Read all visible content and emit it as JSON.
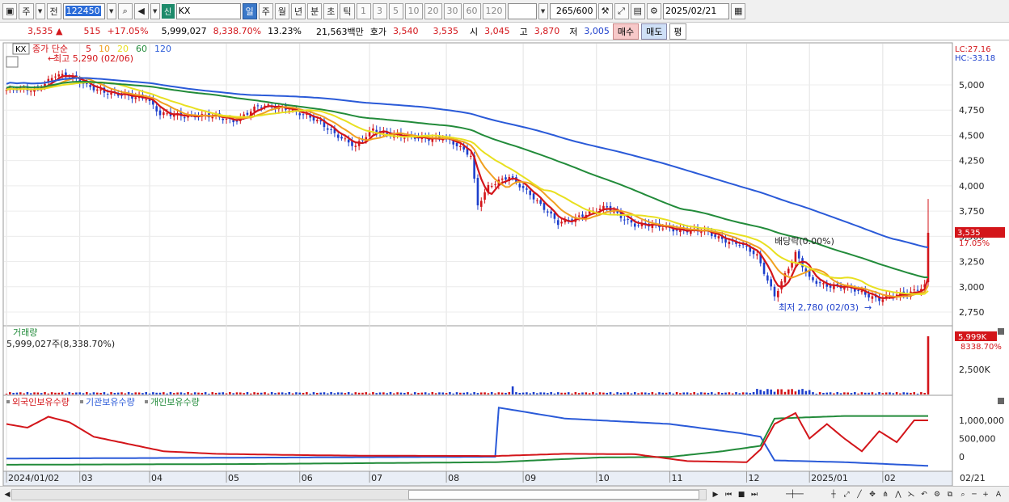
{
  "toolbar": {
    "period_ju": "주",
    "jeon_label": "전",
    "stock_code": "122450",
    "new_badge": "신",
    "stock_name": "KX",
    "periods": [
      "일",
      "주",
      "월",
      "년",
      "분",
      "초",
      "틱"
    ],
    "selected_period": "일",
    "intervals": [
      "1",
      "3",
      "5",
      "10",
      "20",
      "30",
      "60",
      "120"
    ],
    "count_value": "265",
    "count_total": "/600",
    "date_value": "2025/02/21"
  },
  "infobar": {
    "price": "3,535",
    "change_arrow": "▲",
    "change": "515",
    "change_pct": "+17.05%",
    "volume": "5,999,027",
    "volume_pct": "8,338.70%",
    "turnover": "13.23%",
    "amount": "21,563백만",
    "hoga_label": "호가",
    "ask": "3,540",
    "bid": "3,535",
    "open_label": "시",
    "open": "3,045",
    "high_label": "고",
    "high": "3,870",
    "low_label": "저",
    "low": "3,005",
    "buy_label": "매수",
    "sell_label": "매도",
    "p_label": "평"
  },
  "price_panel": {
    "title_name": "KX",
    "legend_label": "종가 단순",
    "ma_periods": [
      {
        "label": "5",
        "color": "#d3151a"
      },
      {
        "label": "10",
        "color": "#f0a020"
      },
      {
        "label": "20",
        "color": "#e8e020"
      },
      {
        "label": "60",
        "color": "#228b3a"
      },
      {
        "label": "120",
        "color": "#2a5ad8"
      }
    ],
    "max_annotation": "최고 5,290 (02/06)",
    "min_annotation": "최저 2,780 (02/03)",
    "event_annotation": "배당락(0.00%)",
    "lc": "LC:27.16",
    "hc": "HC:-33.18",
    "current_price_tag": "3,535",
    "current_pct_tag": "17.05%",
    "y_ticks": [
      "5,000",
      "4,750",
      "4,500",
      "4,250",
      "4,000",
      "3,750",
      "3,500",
      "3,250",
      "3,000",
      "2,750"
    ]
  },
  "volume_panel": {
    "title": "거래량",
    "value_text": "5,999,027주(8,338.70%)",
    "tag_value": "5,999K",
    "tag_pct": "8338.70%",
    "y_ticks": [
      "2,500K"
    ]
  },
  "holding_panel": {
    "legend": [
      {
        "label": "외국인보유수량",
        "color": "#d3151a"
      },
      {
        "label": "기관보유수량",
        "color": "#2a5ad8"
      },
      {
        "label": "개인보유수량",
        "color": "#228b3a"
      }
    ],
    "y_ticks": [
      "1,000,000",
      "500,000",
      "0"
    ]
  },
  "x_axis": {
    "labels": [
      "2024/01/02",
      "03",
      "04",
      "05",
      "06",
      "07",
      "08",
      "09",
      "10",
      "11",
      "12",
      "2025/01",
      "02"
    ],
    "end_label": "02/21"
  },
  "colors": {
    "up": "#d3151a",
    "down": "#1d3fcc",
    "ma5": "#d3151a",
    "ma10": "#f0a020",
    "ma20": "#e8e020",
    "ma60": "#228b3a",
    "ma120": "#2a5ad8"
  }
}
